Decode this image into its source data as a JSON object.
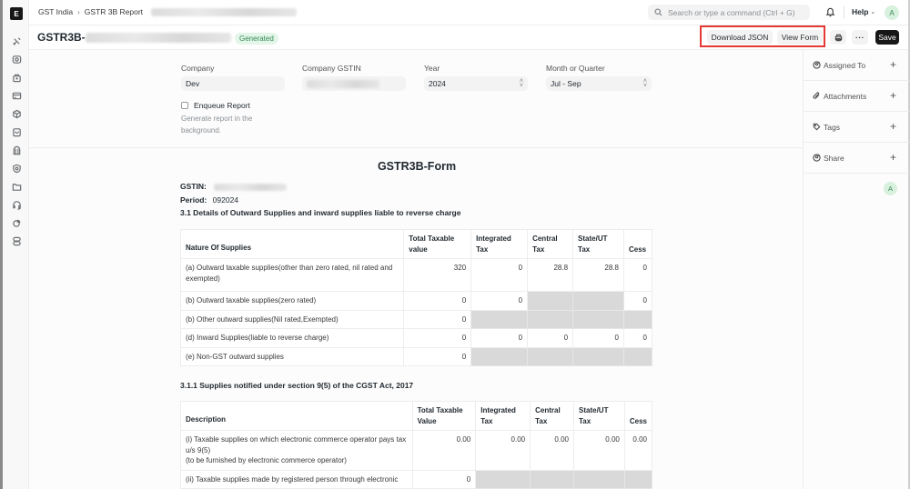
{
  "app": {
    "logo_letter": "E",
    "sidebar_icons": [
      "tools-icon",
      "accounting-icon",
      "buying-icon",
      "selling-icon",
      "stock-icon",
      "shopping-bag-icon",
      "assets-icon",
      "quality-icon",
      "projects-icon",
      "support-icon",
      "crm-icon",
      "integrations-icon"
    ]
  },
  "navbar": {
    "breadcrumbs": [
      "GST India",
      "GSTR 3B Report"
    ],
    "search_placeholder": "Search or type a command (Ctrl + G)",
    "help_label": "Help",
    "avatar_letter": "A"
  },
  "header": {
    "title_prefix": "GSTR3B-",
    "status": "Generated",
    "download_json": "Download JSON",
    "view_form": "View Form",
    "more": "···",
    "save": "Save"
  },
  "form": {
    "company_label": "Company",
    "company_value": "Dev",
    "gstin_label": "Company GSTIN",
    "year_label": "Year",
    "year_value": "2024",
    "period_label": "Month or Quarter",
    "period_value": "Jul - Sep",
    "enqueue_label": "Enqueue Report",
    "enqueue_checked": false,
    "enqueue_hint": "Generate report in the background."
  },
  "right_sidebar": {
    "items": [
      {
        "label": "Assigned To",
        "icon": "assign-icon"
      },
      {
        "label": "Attachments",
        "icon": "paperclip-icon"
      },
      {
        "label": "Tags",
        "icon": "tag-icon"
      },
      {
        "label": "Share",
        "icon": "share-icon"
      }
    ],
    "avatar_letter": "A"
  },
  "report": {
    "title": "GSTR3B-Form",
    "gstin_label": "GSTIN:",
    "period_label": "Period:",
    "period_value": "092024",
    "section_31": "3.1  Details of Outward Supplies and inward supplies liable to reverse charge",
    "table_31": {
      "headers": [
        "Nature Of Supplies",
        "Total Taxable value",
        "Integrated Tax",
        "Central Tax",
        "State/UT Tax",
        "Cess"
      ],
      "rows": [
        {
          "label": "(a) Outward taxable supplies(other than zero rated, nil rated and exempted)",
          "cells": [
            "320",
            "0",
            "28.8",
            "28.8",
            "0"
          ]
        },
        {
          "label": "(b) Outward taxable supplies(zero rated)",
          "cells": [
            "0",
            "0",
            null,
            null,
            "0"
          ]
        },
        {
          "label": "(b) Other outward supplies(Nil rated,Exempted)",
          "cells": [
            "0",
            null,
            null,
            null,
            null
          ]
        },
        {
          "label": "(d) Inward Supplies(liable to reverse charge)",
          "cells": [
            "0",
            "0",
            "0",
            "0",
            "0"
          ]
        },
        {
          "label": "(e) Non-GST outward supplies",
          "cells": [
            "0",
            null,
            null,
            null,
            null
          ]
        }
      ]
    },
    "section_311": "3.1.1  Supplies notified under section 9(5) of the CGST Act, 2017",
    "table_311": {
      "headers": [
        "Description",
        "Total Taxable Value",
        "Integrated Tax",
        "Central Tax",
        "State/UT Tax",
        "Cess"
      ],
      "rows": [
        {
          "label": "(i) Taxable supplies on which electronic commerce operator pays tax u/s 9(5)",
          "sub": "(to be furnished by electronic commerce operator)",
          "cells": [
            "0.00",
            "0.00",
            "0.00",
            "0.00",
            "0.00"
          ]
        },
        {
          "label": "(ii) Taxable supplies made by registered person through electronic",
          "sub": "",
          "cells": [
            "0",
            null,
            null,
            null,
            null
          ]
        }
      ]
    }
  }
}
